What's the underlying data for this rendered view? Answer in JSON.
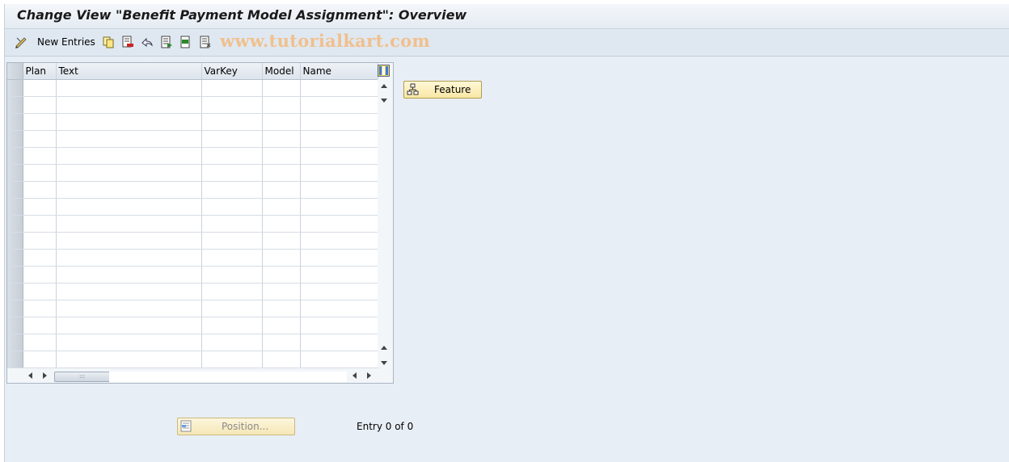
{
  "window": {
    "title": "Change View \"Benefit Payment Model Assignment\": Overview"
  },
  "toolbar": {
    "new_entries_label": "New Entries",
    "watermark": "www.tutorialkart.com",
    "icons": [
      "display-change-icon",
      "copy-icon",
      "delete-icon",
      "undo-icon",
      "select-all-icon",
      "select-block-icon",
      "deselect-all-icon"
    ]
  },
  "table": {
    "columns": [
      "Plan",
      "Text",
      "VarKey",
      "Model",
      "Name"
    ],
    "rows": [],
    "empty_row_count": 17
  },
  "side": {
    "feature_label": "Feature"
  },
  "footer": {
    "position_label": "Position...",
    "entry_info": "Entry 0 of 0"
  },
  "colors": {
    "background": "#e8eef5",
    "toolbar": "#dfe8f1",
    "button_yellow": "#f8e7a4",
    "watermark": "#f0c08e"
  }
}
